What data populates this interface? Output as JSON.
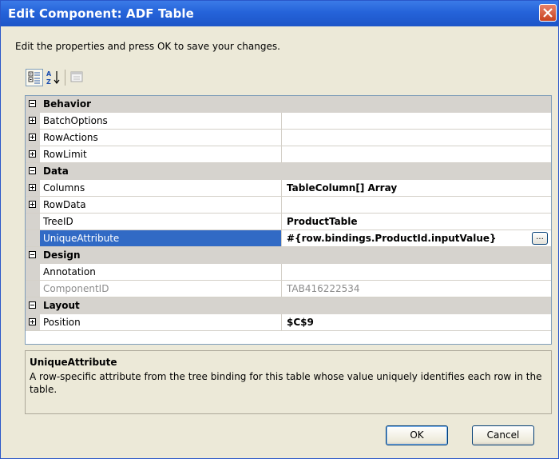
{
  "window": {
    "title": "Edit Component: ADF Table"
  },
  "instruction": "Edit the properties and press OK to save your changes.",
  "toolbar": {
    "categorized": "categorized-view-icon",
    "alphabetical": "alphabetical-sort-icon",
    "pages": "property-pages-icon"
  },
  "grid": {
    "rows": [
      {
        "type": "category",
        "name": "Behavior",
        "expander": "minus"
      },
      {
        "type": "property",
        "name": "BatchOptions",
        "value": "",
        "expander": "plus"
      },
      {
        "type": "property",
        "name": "RowActions",
        "value": "",
        "expander": "plus"
      },
      {
        "type": "property",
        "name": "RowLimit",
        "value": "",
        "expander": "plus"
      },
      {
        "type": "category",
        "name": "Data",
        "expander": "minus"
      },
      {
        "type": "property",
        "name": "Columns",
        "value": "TableColumn[] Array",
        "expander": "plus"
      },
      {
        "type": "property",
        "name": "RowData",
        "value": "",
        "expander": "plus"
      },
      {
        "type": "property",
        "name": "TreeID",
        "value": "ProductTable"
      },
      {
        "type": "property",
        "name": "UniqueAttribute",
        "value": "#{row.bindings.ProductId.inputValue}",
        "selected": true,
        "button": "..."
      },
      {
        "type": "category",
        "name": "Design",
        "expander": "minus"
      },
      {
        "type": "property",
        "name": "Annotation",
        "value": ""
      },
      {
        "type": "property",
        "name": "ComponentID",
        "value": "TAB416222534",
        "readonly": true
      },
      {
        "type": "category",
        "name": "Layout",
        "expander": "minus"
      },
      {
        "type": "property",
        "name": "Position",
        "value": "$C$9",
        "expander": "plus"
      }
    ]
  },
  "help": {
    "title": "UniqueAttribute",
    "text": "A row-specific attribute from the tree binding for this table whose value uniquely identifies each row in the table."
  },
  "buttons": {
    "ok": "OK",
    "cancel": "Cancel"
  }
}
